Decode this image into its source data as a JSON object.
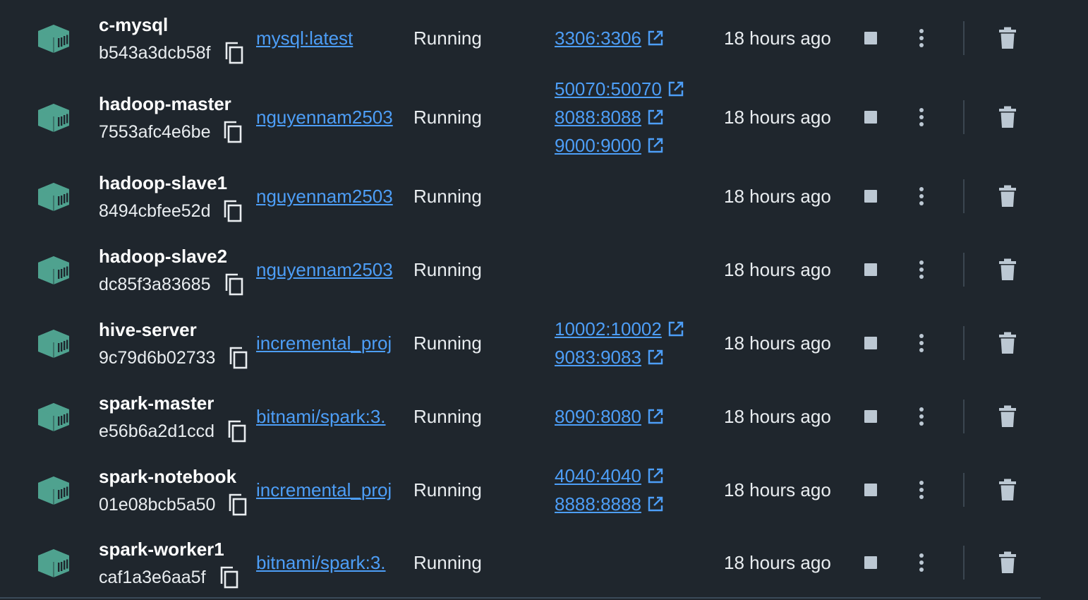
{
  "containers": [
    {
      "name": "c-mysql",
      "id": "b543a3dcb58f",
      "image": "mysql:latest",
      "status": "Running",
      "ports": [
        "3306:3306"
      ],
      "last_started": "18 hours ago"
    },
    {
      "name": "hadoop-master",
      "id": "7553afc4e6be",
      "image": "nguyennam2503",
      "status": "Running",
      "ports": [
        "50070:50070",
        "8088:8088",
        "9000:9000"
      ],
      "last_started": "18 hours ago"
    },
    {
      "name": "hadoop-slave1",
      "id": "8494cbfee52d",
      "image": "nguyennam2503",
      "status": "Running",
      "ports": [],
      "last_started": "18 hours ago"
    },
    {
      "name": "hadoop-slave2",
      "id": "dc85f3a83685",
      "image": "nguyennam2503",
      "status": "Running",
      "ports": [],
      "last_started": "18 hours ago"
    },
    {
      "name": "hive-server",
      "id": "9c79d6b02733",
      "image": "incremental_proj",
      "status": "Running",
      "ports": [
        "10002:10002",
        "9083:9083"
      ],
      "last_started": "18 hours ago"
    },
    {
      "name": "spark-master",
      "id": "e56b6a2d1ccd",
      "image": "bitnami/spark:3.",
      "status": "Running",
      "ports": [
        "8090:8080"
      ],
      "last_started": "18 hours ago"
    },
    {
      "name": "spark-notebook",
      "id": "01e08bcb5a50",
      "image": "incremental_proj",
      "status": "Running",
      "ports": [
        "4040:4040",
        "8888:8888"
      ],
      "last_started": "18 hours ago"
    },
    {
      "name": "spark-worker1",
      "id": "caf1a3e6aa5f",
      "image": "bitnami/spark:3.",
      "status": "Running",
      "ports": [],
      "last_started": "18 hours ago"
    }
  ],
  "icons": {
    "container": "container-icon",
    "copy": "copy-icon",
    "external_link": "external-link-icon",
    "stop": "stop-icon",
    "more": "more-vertical-icon",
    "delete": "trash-icon"
  },
  "colors": {
    "background": "#1f262d",
    "link": "#4d9ef7",
    "container_icon": "#4fa28f",
    "control_icon": "#bcc8d3"
  }
}
